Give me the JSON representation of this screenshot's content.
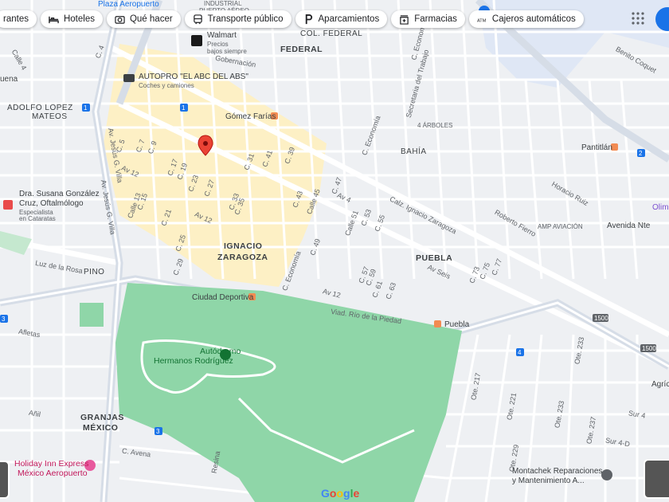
{
  "chips": [
    {
      "label": "rantes",
      "icon": "restaurant-icon"
    },
    {
      "label": "Hoteles",
      "icon": "bed-icon"
    },
    {
      "label": "Qué hacer",
      "icon": "camera-icon"
    },
    {
      "label": "Transporte público",
      "icon": "train-icon"
    },
    {
      "label": "Aparcamientos",
      "icon": "parking-icon"
    },
    {
      "label": "Farmacias",
      "icon": "pharmacy-icon"
    },
    {
      "label": "Cajeros automáticos",
      "icon": "atm-icon"
    }
  ],
  "neighborhoods": {
    "federal": "FEDERAL",
    "col_federal": "COL. FEDERAL",
    "industrial": "INDUSTRIAL",
    "puerto_aereo": "PUERTO AÉREO",
    "adolfo1": "ADOLFO LOPEZ",
    "adolfo2": "MATEOS",
    "ignacio1": "IGNACIO",
    "ignacio2": "ZARAGOZA",
    "puebla": "PUEBLA",
    "bahia": "BAHÍA",
    "cuatro_arboles": "4 ÁRBOLES",
    "pino": "PINO",
    "granjas1": "GRANJAS",
    "granjas2": "MÉXICO",
    "uena": "uena"
  },
  "pois": {
    "walmart": "Walmart",
    "walmart_sub1": "Precios",
    "walmart_sub2": "bajos siempre",
    "autopro": "AUTOPRO \"EL ABC DEL ABS\"",
    "autopro_sub": "Coches y camiones",
    "gomez": "Gómez Farías",
    "pantitlan": "Pantitlán",
    "dra1": "Dra. Susana González",
    "dra2": "Cruz, Oftalmólogo",
    "dra_sub1": "Especialista",
    "dra_sub2": "en Cataratas",
    "ciudad_deportiva": "Ciudad Deportiva",
    "puebla_station": "Puebla",
    "amp_aviacion": "AMP AVIACIÓN",
    "autodromo1": "Autódromo",
    "autodromo2": "Hermanos Rodríguez",
    "holiday1": "Holiday Inn Express",
    "holiday2": "México Aeropuerto",
    "montachek1": "Montachek Reparaciones",
    "montachek2": "y Mantenimiento A...",
    "olim": "Olim",
    "plaza": "Plaza Aeropuerto",
    "avenida_nte": "Avenida Nte",
    "agric": "Agríc"
  },
  "streets": {
    "calz_ignacio": "Calz. Ignacio Zaragoza",
    "viad": "Viad. Río de la Piedad",
    "av12a": "Av 12",
    "av12b": "Av 12",
    "av12c": "Av 12",
    "av_seis": "Av Seis",
    "av4": "Av 4",
    "c_economia": "C. Economía",
    "c_economia2": "C. Economía",
    "c47": "C. 47",
    "c45": "Calle 45",
    "c49": "C. 49",
    "c51": "Calle 51",
    "c53": "C. 53",
    "c55": "C. 55",
    "c57": "C. 57",
    "c59": "C. 59",
    "c61": "C. 61",
    "c63": "C. 63",
    "c73": "C. 73",
    "c75": "C. 75",
    "c77": "C. 77",
    "c17": "C. 17",
    "c19": "C. 19",
    "c21": "C. 21",
    "c23": "C. 23",
    "c25": "C. 25",
    "c27": "C. 27",
    "c29": "C. 29",
    "c31": "C. 31",
    "c33": "C. 33",
    "c35": "C. 35",
    "c39": "C. 39",
    "c41": "C. 41",
    "c43": "C. 43",
    "c5": "C. 5",
    "c7": "C. 7",
    "c9": "C. 9",
    "c13": "Calle 13",
    "c15": "C. 15",
    "c4": "C. 4",
    "jesus_villa": "Av. Jesús G. Villa",
    "jesus_villa2": "Av. Jesús G. Villa",
    "luz_rosa": "Luz de la Rosa",
    "aflletas": "Afletas",
    "anil": "Añil",
    "c_avena": "C. Avena",
    "resina": "Resina",
    "ote217": "Ote. 217",
    "ote221": "Ote. 221",
    "ote229": "Ote. 229",
    "ote233": "Ote. 233",
    "ote233b": "Ote. 233",
    "ote237": "Ote. 237",
    "sur4d": "Sur 4-D",
    "sur4": "Sur 4",
    "horacio": "Horacio Ruiz",
    "roberto": "Roberto Fierro",
    "benito": "Benito Coquet",
    "secretaria": "Secretaria del Trabajo",
    "gobernacion": "Gobernación",
    "c_economia_top": "C. Economía",
    "calle4": "Calle 4"
  },
  "shields": {
    "s1": "1",
    "s2": "1",
    "s3": "3",
    "s4": "3",
    "s5": "4",
    "s6": "1500",
    "s7": "1500",
    "s8": "2"
  },
  "brand": "Google",
  "colors": {
    "park": "#8fd6a8",
    "road": "#ffffff",
    "highway": "#b6c4d6",
    "highlight": "#fdf0c5",
    "water": "#bcd7f2",
    "pin": "#ea4335"
  }
}
